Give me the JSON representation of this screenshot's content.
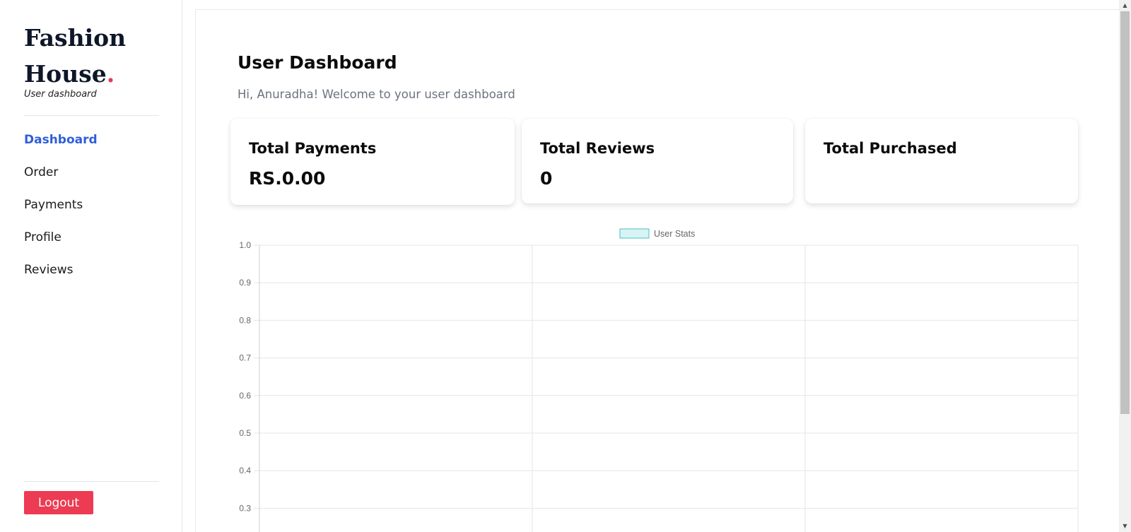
{
  "brand": {
    "line1": "Fashion",
    "line2": "House",
    "dot": ".",
    "subtitle": "User dashboard"
  },
  "nav": {
    "items": [
      {
        "label": "Dashboard",
        "active": true
      },
      {
        "label": "Order"
      },
      {
        "label": "Payments"
      },
      {
        "label": "Profile"
      },
      {
        "label": "Reviews"
      }
    ]
  },
  "logout_label": "Logout",
  "main": {
    "title": "User Dashboard",
    "welcome": "Hi, Anuradha! Welcome to your user dashboard"
  },
  "cards": [
    {
      "title": "Total Payments",
      "value": "RS.0.00"
    },
    {
      "title": "Total Reviews",
      "value": "0"
    },
    {
      "title": "Total Purchased",
      "value": ""
    }
  ],
  "colors": {
    "accent": "#2f5ed8",
    "brand_dot": "#e63950",
    "logout": "#ec3b52",
    "series_fill": "#d8f3f3",
    "series_stroke": "#4bc0c0"
  },
  "chart_data": {
    "type": "bar",
    "categories": [
      "",
      "",
      ""
    ],
    "series": [
      {
        "name": "User Stats",
        "values": []
      }
    ],
    "yticks": [
      "1.0",
      "0.9",
      "0.8",
      "0.7",
      "0.6",
      "0.5",
      "0.4",
      "0.3"
    ],
    "ylim": [
      0.3,
      1.0
    ],
    "legend": "top-center",
    "grid": true
  }
}
